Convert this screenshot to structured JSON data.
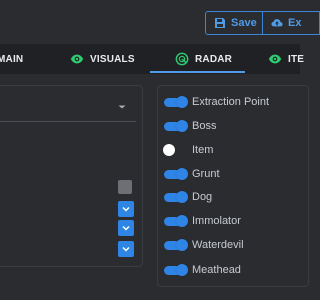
{
  "header": {
    "save_label": "Save",
    "export_label": "Ex"
  },
  "tabs": [
    {
      "label": "MAIN",
      "icon": "none"
    },
    {
      "label": "VISUALS",
      "icon": "eye-icon"
    },
    {
      "label": "RADAR",
      "icon": "radar-icon",
      "active": true
    },
    {
      "label": "ITE",
      "icon": "eye-icon"
    }
  ],
  "radar_toggles": [
    {
      "label": "Extraction Point",
      "on": true
    },
    {
      "label": "Boss",
      "on": true
    },
    {
      "label": "Item",
      "on": false
    },
    {
      "label": "Grunt",
      "on": true
    },
    {
      "label": "Dog",
      "on": true
    },
    {
      "label": "Immolator",
      "on": true
    },
    {
      "label": "Waterdevil",
      "on": true
    },
    {
      "label": "Meathead",
      "on": true
    }
  ],
  "colors": {
    "accent": "#2f85e6",
    "tab_icon": "#2ecc71",
    "background": "#2b2c30",
    "tab_bar": "#202125"
  }
}
